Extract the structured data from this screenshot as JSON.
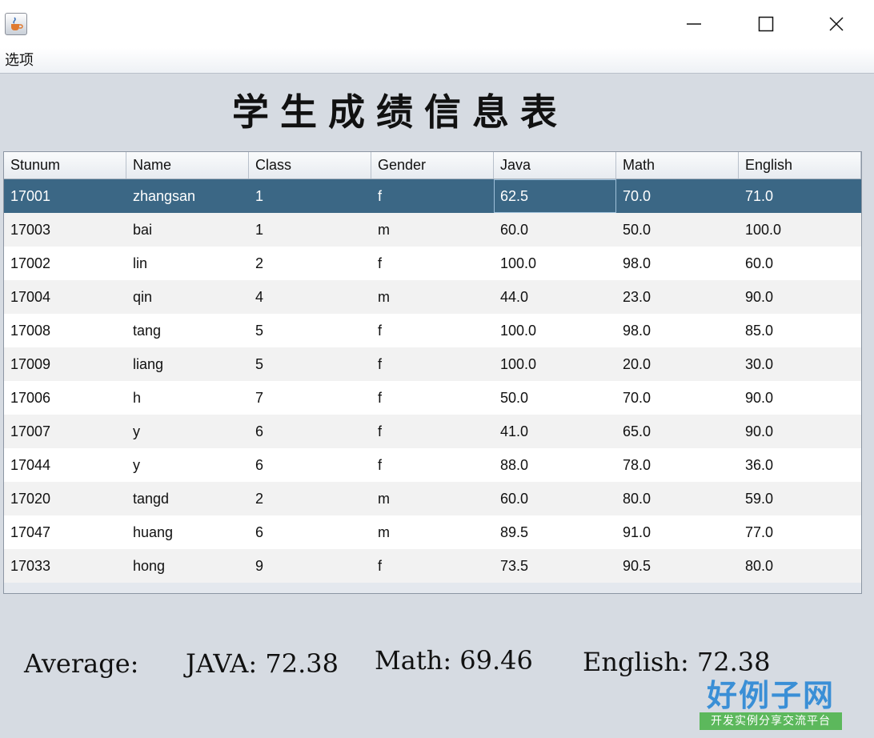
{
  "window": {
    "icon": "java-coffee-icon",
    "controls": [
      "minimize-icon",
      "maximize-icon",
      "close-icon"
    ]
  },
  "menu": {
    "items": [
      {
        "label": "选项"
      }
    ]
  },
  "heading": "学生成绩信息表",
  "table": {
    "columns": [
      "Stunum",
      "Name",
      "Class",
      "Gender",
      "Java",
      "Math",
      "English"
    ],
    "selected_row": 0,
    "rows": [
      [
        "17001",
        "zhangsan",
        "1",
        "f",
        "62.5",
        "70.0",
        "71.0"
      ],
      [
        "17003",
        "bai",
        "1",
        "m",
        "60.0",
        "50.0",
        "100.0"
      ],
      [
        "17002",
        "lin",
        "2",
        "f",
        "100.0",
        "98.0",
        "60.0"
      ],
      [
        "17004",
        "qin",
        "4",
        "m",
        "44.0",
        "23.0",
        "90.0"
      ],
      [
        "17008",
        "tang",
        "5",
        "f",
        "100.0",
        "98.0",
        "85.0"
      ],
      [
        "17009",
        "liang",
        "5",
        "f",
        "100.0",
        "20.0",
        "30.0"
      ],
      [
        "17006",
        "h",
        "7",
        "f",
        "50.0",
        "70.0",
        "90.0"
      ],
      [
        "17007",
        "y",
        "6",
        "f",
        "41.0",
        "65.0",
        "90.0"
      ],
      [
        "17044",
        "y",
        "6",
        "f",
        "88.0",
        "78.0",
        "36.0"
      ],
      [
        "17020",
        "tangd",
        "2",
        "m",
        "60.0",
        "80.0",
        "59.0"
      ],
      [
        "17047",
        "huang",
        "6",
        "m",
        "89.5",
        "91.0",
        "77.0"
      ],
      [
        "17033",
        "hong",
        "9",
        "f",
        "73.5",
        "90.5",
        "80.0"
      ]
    ]
  },
  "averages": {
    "label": "Average:",
    "java": "JAVA: 72.38",
    "math": "Math: 69.46",
    "english": "English: 72.38"
  },
  "watermark": {
    "title": "好例子网",
    "subtitle": "开发实例分享交流平台"
  },
  "colors": {
    "selected_row": "#3b6785",
    "background": "#d6dbe2",
    "logo_blue": "#3a8fd6",
    "logo_green": "#5cb85c"
  }
}
